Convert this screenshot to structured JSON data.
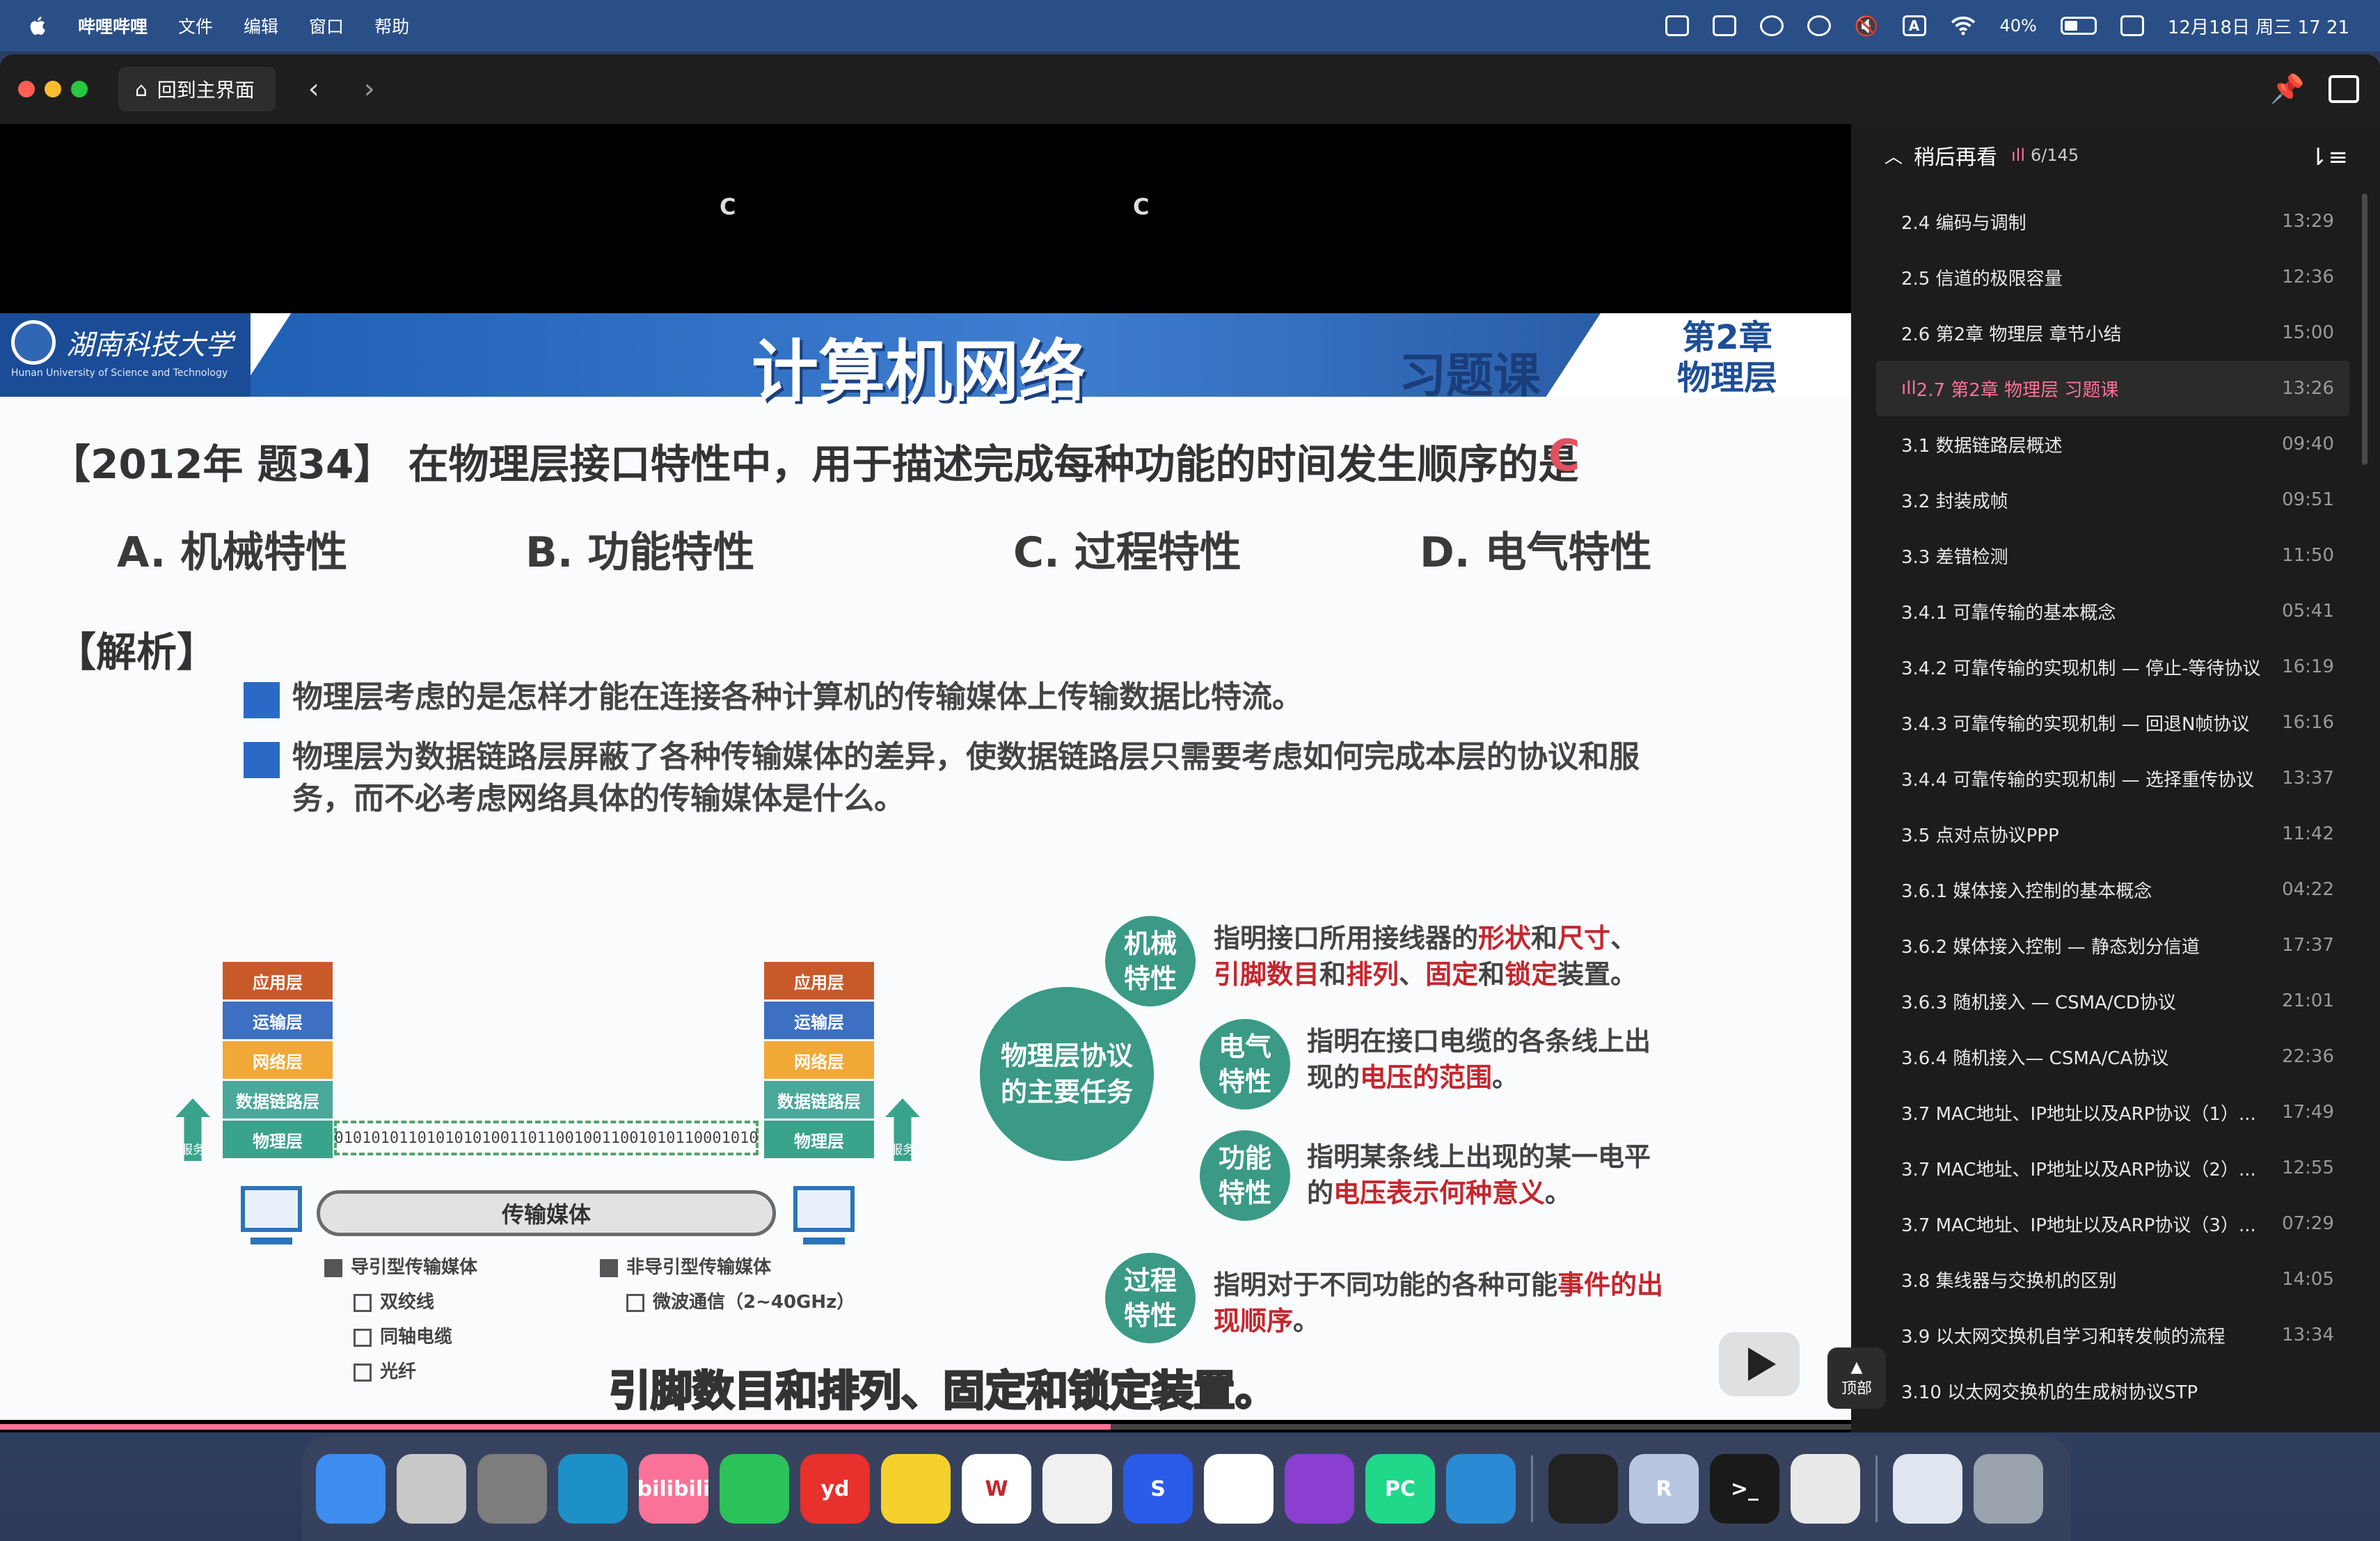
{
  "menubar": {
    "app_name": "哔哩哔哩",
    "menus": [
      "文件",
      "编辑",
      "窗口",
      "帮助"
    ],
    "battery": "40%",
    "datetime": "12月18日 周三  17 21",
    "input_indicator": "A"
  },
  "titlebar": {
    "home_label": "回到主界面"
  },
  "video": {
    "top_letters": [
      "C",
      "C"
    ],
    "slide": {
      "logo_name": "湖南科技大学",
      "logo_sub": "Hunan University of Science and Technology",
      "course_title": "计算机网络",
      "exercise_tag": "习题课",
      "chapter_tag_line1": "第2章",
      "chapter_tag_line2": "物理层",
      "question": "【2012年 题34】 在物理层接口特性中，用于描述完成每种功能的时间发生顺序的是",
      "answer": "C",
      "options": [
        "A. 机械特性",
        "B. 功能特性",
        "C. 过程特性",
        "D. 电气特性"
      ],
      "analysis_title": "【解析】",
      "bullets": [
        "物理层考虑的是怎样才能在连接各种计算机的传输媒体上传输数据比特流。",
        "物理层为数据链路层屏蔽了各种传输媒体的差异，使数据链路层只需要考虑如何完成本层的协议和服务，而不必考虑网络具体的传输媒体是什么。"
      ],
      "layers": [
        "应用层",
        "运输层",
        "网络层",
        "数据链路层",
        "物理层"
      ],
      "service_label": "服务",
      "bits": "0101010110101010100110110010011001010110001010",
      "medium_label": "传输媒体",
      "guided_title": "导引型传输媒体",
      "guided_items": [
        "双绞线",
        "同轴电缆",
        "光纤"
      ],
      "unguided_title": "非导引型传输媒体",
      "unguided_items": [
        "微波通信（2~40GHz）"
      ],
      "center_circle": "物理层协议的主要任务",
      "tasks": [
        {
          "name": "机械特性",
          "pre": "指明接口所用接线器的",
          "hl1": "形状",
          "mid1": "和",
          "hl2": "尺寸",
          "mid2": "、",
          "hl3": "引脚数目",
          "mid3": "和",
          "hl4": "排列",
          "mid4": "、",
          "hl5": "固定",
          "mid5": "和",
          "hl6": "锁定",
          "post": "装置。"
        },
        {
          "name": "电气特性",
          "pre": "指明在接口电缆的各条线上出现的",
          "hl1": "电压的范围",
          "post": "。"
        },
        {
          "name": "功能特性",
          "pre": "指明某条线上出现的某一电平的",
          "hl1": "电压表示何种意义",
          "post": "。"
        },
        {
          "name": "过程特性",
          "pre": "指明对于不同功能的各种可能",
          "hl1": "事件的出现顺序",
          "post": "。"
        }
      ]
    },
    "subtitle": "引脚数目和排列、固定和锁定装置。",
    "progress": 0.6
  },
  "sidebar": {
    "title": "稍后再看",
    "count": "6/145",
    "top_label": "顶部",
    "items": [
      {
        "title": "2.4 编码与调制",
        "dur": "13:29"
      },
      {
        "title": "2.5 信道的极限容量",
        "dur": "12:36"
      },
      {
        "title": "2.6 第2章 物理层 章节小结",
        "dur": "15:00"
      },
      {
        "title": "2.7 第2章 物理层 习题课",
        "dur": "13:26",
        "active": true
      },
      {
        "title": "3.1 数据链路层概述",
        "dur": "09:40"
      },
      {
        "title": "3.2 封装成帧",
        "dur": "09:51"
      },
      {
        "title": "3.3 差错检测",
        "dur": "11:50"
      },
      {
        "title": "3.4.1 可靠传输的基本概念",
        "dur": "05:41"
      },
      {
        "title": "3.4.2 可靠传输的实现机制 — 停止-等待协议",
        "dur": "16:19"
      },
      {
        "title": "3.4.3 可靠传输的实现机制 — 回退N帧协议",
        "dur": "16:16"
      },
      {
        "title": "3.4.4 可靠传输的实现机制 — 选择重传协议",
        "dur": "13:37"
      },
      {
        "title": "3.5 点对点协议PPP",
        "dur": "11:42"
      },
      {
        "title": "3.6.1 媒体接入控制的基本概念",
        "dur": "04:22"
      },
      {
        "title": "3.6.2 媒体接入控制 — 静态划分信道",
        "dur": "17:37"
      },
      {
        "title": "3.6.3 随机接入 — CSMA/CD协议",
        "dur": "21:01"
      },
      {
        "title": "3.6.4 随机接入— CSMA/CA协议",
        "dur": "22:36"
      },
      {
        "title": "3.7 MAC地址、IP地址以及ARP协议（1）...",
        "dur": "17:49"
      },
      {
        "title": "3.7 MAC地址、IP地址以及ARP协议（2）...",
        "dur": "12:55"
      },
      {
        "title": "3.7 MAC地址、IP地址以及ARP协议（3）...",
        "dur": "07:29"
      },
      {
        "title": "3.8 集线器与交换机的区别",
        "dur": "14:05"
      },
      {
        "title": "3.9 以太网交换机自学习和转发帧的流程",
        "dur": "13:34"
      },
      {
        "title": "3.10 以太网交换机的生成树协议STP",
        "dur": ""
      }
    ]
  },
  "dock": {
    "apps": [
      {
        "name": "finder-icon",
        "label": "",
        "color": "#3d8cf0"
      },
      {
        "name": "launchpad-icon",
        "label": "",
        "color": "#c8c8c8"
      },
      {
        "name": "system-settings-icon",
        "label": "",
        "color": "#7d7d7d"
      },
      {
        "name": "edge-icon",
        "label": "",
        "color": "#1e90c8"
      },
      {
        "name": "bilibili-icon",
        "label": "bilibili",
        "color": "#fb7299"
      },
      {
        "name": "wechat-icon",
        "label": "",
        "color": "#2bc25a"
      },
      {
        "name": "youdao-icon",
        "label": "yd",
        "color": "#e8302c"
      },
      {
        "name": "qqmusic-icon",
        "label": "",
        "color": "#f5d12e"
      },
      {
        "name": "wps-icon",
        "label": "W",
        "color": "#ffffff"
      },
      {
        "name": "cat-icon",
        "label": "",
        "color": "#f0f0f0"
      },
      {
        "name": "s-app-icon",
        "label": "S",
        "color": "#2a5be8"
      },
      {
        "name": "chatgpt-icon",
        "label": "",
        "color": "#ffffff"
      },
      {
        "name": "github-icon",
        "label": "",
        "color": "#8a3fd1"
      },
      {
        "name": "pycharm-icon",
        "label": "PC",
        "color": "#21d789"
      },
      {
        "name": "vscode-icon",
        "label": "",
        "color": "#2a8ad4"
      },
      {
        "name": "activity-monitor-icon",
        "label": "",
        "color": "#222222"
      },
      {
        "name": "r-icon",
        "label": "R",
        "color": "#b7c7e2"
      },
      {
        "name": "terminal-icon",
        "label": ">_",
        "color": "#1a1a1a"
      },
      {
        "name": "chrome-icon",
        "label": "",
        "color": "#e8e8e8"
      },
      {
        "name": "preview-icon",
        "label": "",
        "color": "#dfe6f0"
      },
      {
        "name": "trash-icon",
        "label": "",
        "color": "#9aa3ad"
      }
    ]
  }
}
